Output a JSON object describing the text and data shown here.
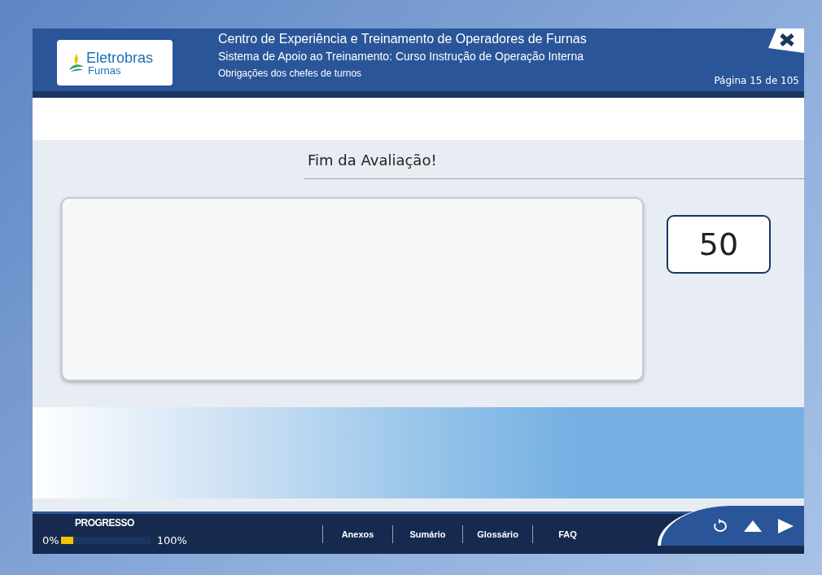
{
  "header": {
    "logo": {
      "brand": "Eletrobras",
      "sub": "Furnas"
    },
    "title": "Centro de Experiência e Treinamento de Operadores de Furnas",
    "subtitle": "Sistema de Apoio ao Treinamento: Curso Instrução de Operação Interna",
    "section": "Obrigações dos chefes de turnos",
    "page": "Página 15 de 105"
  },
  "content": {
    "heading": "Fim da Avaliação!",
    "score": "50"
  },
  "footer": {
    "progress": {
      "label": "PROGRESSO",
      "start": "0%",
      "end": "100%",
      "level": 0.14
    },
    "links": [
      "Anexos",
      "Sumário",
      "Glossário",
      "FAQ"
    ]
  }
}
